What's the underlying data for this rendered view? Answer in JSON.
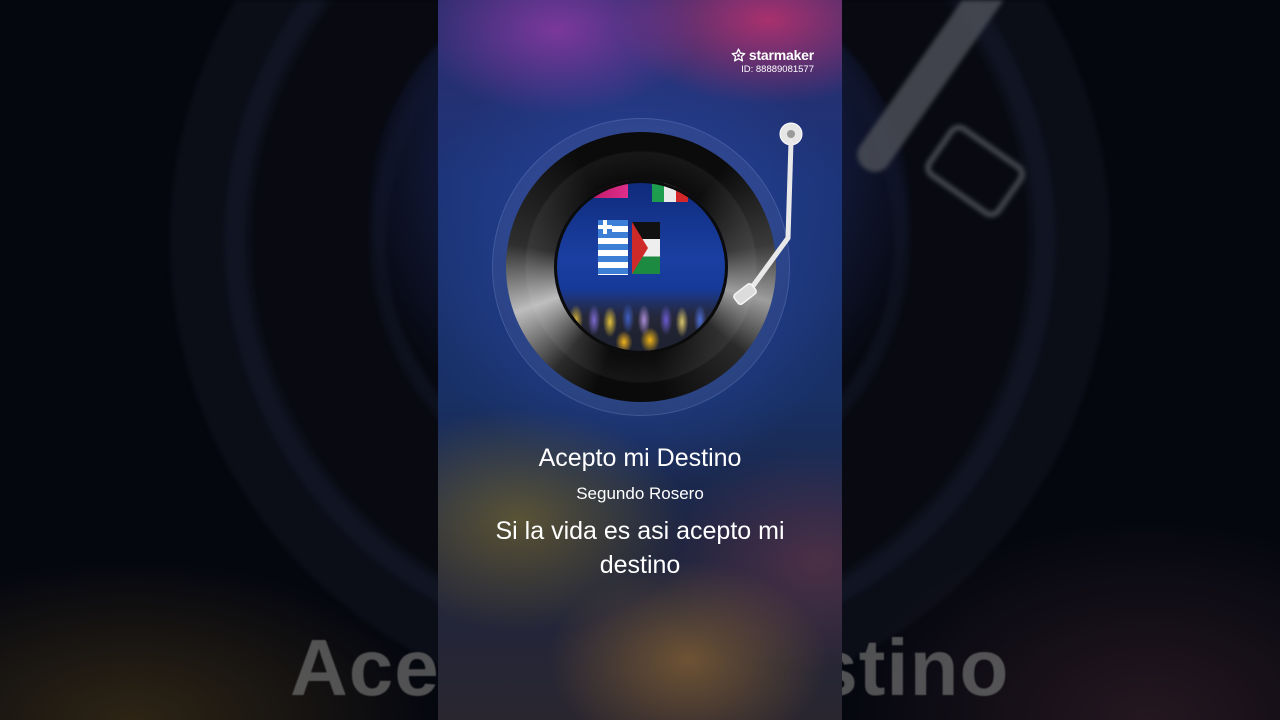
{
  "brand": {
    "name": "starmaker",
    "id_text": "ID: 88889081577",
    "icon": "star-icon"
  },
  "song": {
    "title": "Acepto mi Destino",
    "artist": "Segundo Rosero",
    "lyric_line": "Si la vida es asi acepto mi destino"
  },
  "background": {
    "blurred_title": "Acepto mi Destino"
  },
  "colors": {
    "text": "#ffffff",
    "vinyl": "#0b0b0b",
    "accent_pink": "#d2326e",
    "accent_blue": "#2747a4"
  }
}
